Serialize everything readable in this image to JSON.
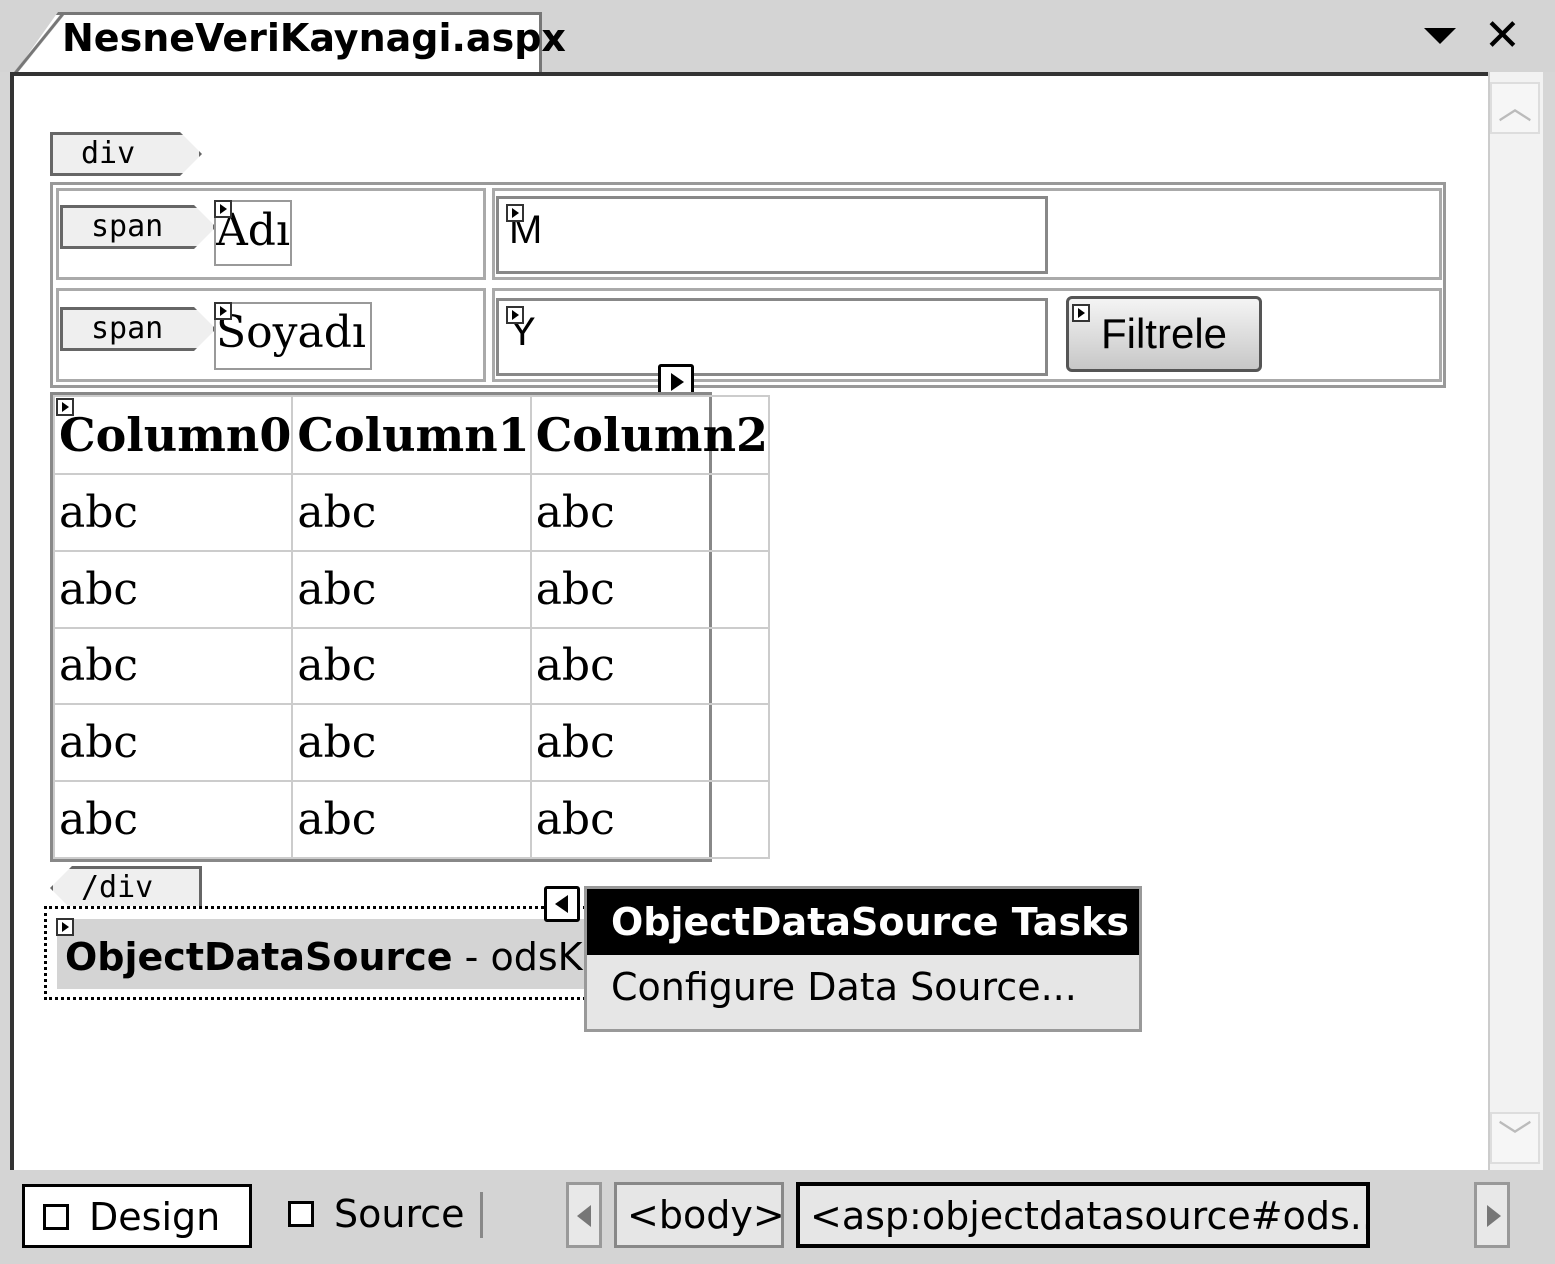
{
  "tab": {
    "title": "NesneVeriKaynagi.aspx",
    "dropdown_icon": "chevron-down-icon",
    "close_icon": "close-icon"
  },
  "tags": {
    "div_open": "div",
    "span1": "span",
    "span2": "span",
    "div_close": "/div"
  },
  "form": {
    "label_ad": "Adı",
    "label_soyad": "Soyadı",
    "textbox_ad": "M",
    "textbox_soyad": "Y",
    "filter_button": "Filtrele"
  },
  "grid": {
    "headers": [
      "Column0",
      "Column1",
      "Column2"
    ],
    "rows": [
      [
        "abc",
        "abc",
        "abc"
      ],
      [
        "abc",
        "abc",
        "abc"
      ],
      [
        "abc",
        "abc",
        "abc"
      ],
      [
        "abc",
        "abc",
        "abc"
      ],
      [
        "abc",
        "abc",
        "abc"
      ]
    ]
  },
  "ods": {
    "type": "ObjectDataSource",
    "name": "- odsKisi"
  },
  "tasks": {
    "header": "ObjectDataSource Tasks",
    "configure": "Configure Data Source..."
  },
  "bottom": {
    "design": "Design",
    "source": "Source",
    "crumb_body": "<body>",
    "crumb_ods": "<asp:objectdatasource#ods...>"
  }
}
